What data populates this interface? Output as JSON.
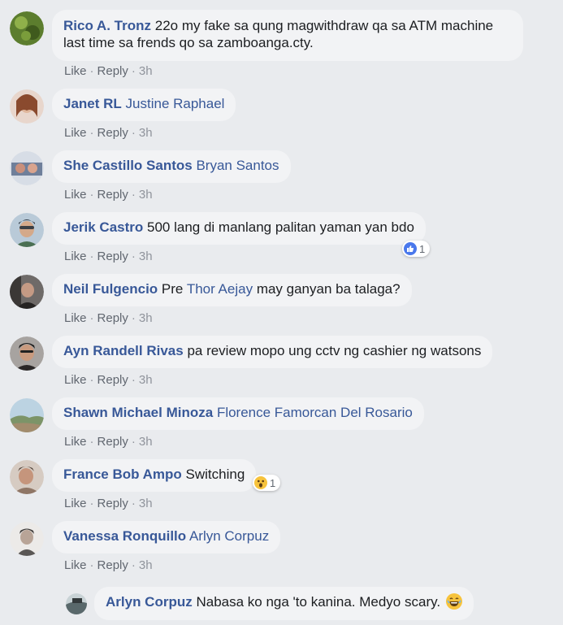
{
  "action_labels": {
    "like": "Like",
    "reply": "Reply",
    "separator": "·"
  },
  "comments": [
    {
      "author": "Rico A. Tronz",
      "text_line1": "22o my fake sa qung magwithdraw qa sa ATM machine",
      "text_line2": "last time sa frends qo sa zamboanga.cty.",
      "time": "3h",
      "avatar_color": "#6b8e3a"
    },
    {
      "author": "Janet RL",
      "tag": "Justine Raphael",
      "time": "3h",
      "avatar_color": "#c9967a"
    },
    {
      "author": "She Castillo Santos",
      "tag": "Bryan Santos",
      "time": "3h",
      "avatar_color": "#5a6f8c"
    },
    {
      "author": "Jerik Castro",
      "text": "500 lang di manlang palitan yaman yan bdo",
      "time": "3h",
      "reaction_count": "1",
      "avatar_color": "#8aa2b5"
    },
    {
      "author": "Neil Fulgencio",
      "text_pre": "Pre",
      "tag": "Thor Aejay",
      "text_post": "may ganyan ba talaga?",
      "time": "3h",
      "avatar_color": "#4e4a48"
    },
    {
      "author": "Ayn Randell Rivas",
      "text": "pa review mopo ung cctv ng cashier ng watsons",
      "time": "3h",
      "avatar_color": "#3d3a3a"
    },
    {
      "author": "Shawn Michael Minoza",
      "tag": "Florence Famorcan Del Rosario",
      "time": "3h",
      "avatar_color": "#8fa8a0"
    },
    {
      "author": "France Bob Ampo",
      "text": "Switching",
      "time": "3h",
      "reaction_count": "1",
      "avatar_color": "#a88f7c"
    },
    {
      "author": "Vanessa Ronquillo",
      "tag": "Arlyn Corpuz",
      "time": "3h",
      "avatar_color": "#9a9a9a"
    }
  ],
  "reply": {
    "author": "Arlyn Corpuz",
    "text": "Nabasa ko nga 'to kanina. Medyo scary.",
    "avatar_color": "#7d8a8c"
  }
}
